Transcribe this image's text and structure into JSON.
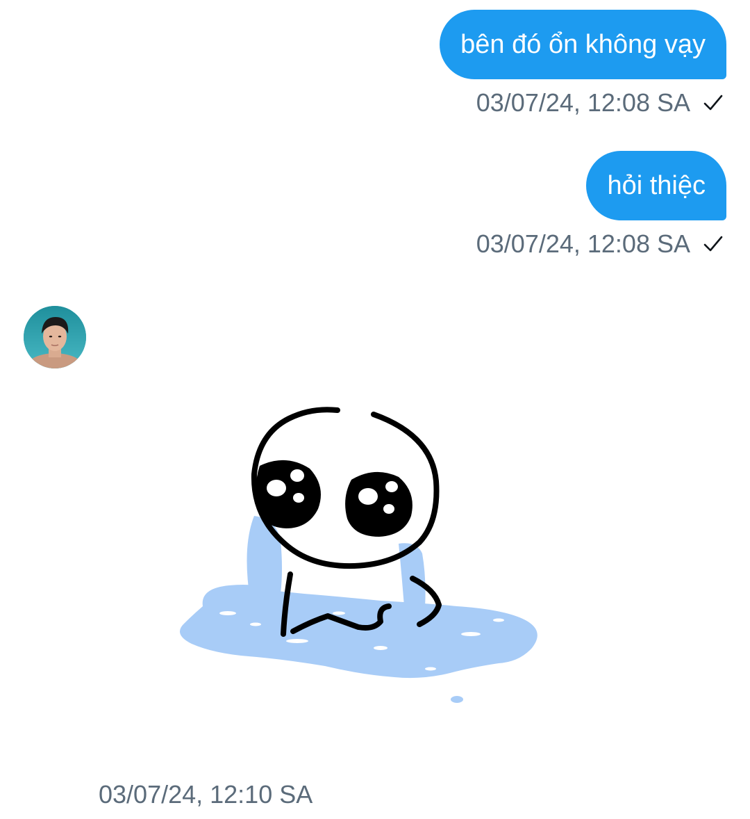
{
  "messages": [
    {
      "direction": "outgoing",
      "text": "bên đó ổn không vạy",
      "timestamp": "03/07/24, 12:08 SA",
      "status_icon": "checkmark-icon"
    },
    {
      "direction": "outgoing",
      "text": "hỏi thiệc",
      "timestamp": "03/07/24, 12:08 SA",
      "status_icon": "checkmark-icon"
    },
    {
      "direction": "incoming",
      "type": "sticker",
      "sticker_icon": "crying-blob-sticker",
      "timestamp": "03/07/24, 12:10 SA",
      "avatar_icon": "contact-avatar"
    }
  ],
  "colors": {
    "outgoing_bubble": "#1d9bf0",
    "outgoing_text": "#ffffff",
    "timestamp_text": "#5b6b7a",
    "tear_blue": "#a8ccf7",
    "background": "#ffffff"
  }
}
